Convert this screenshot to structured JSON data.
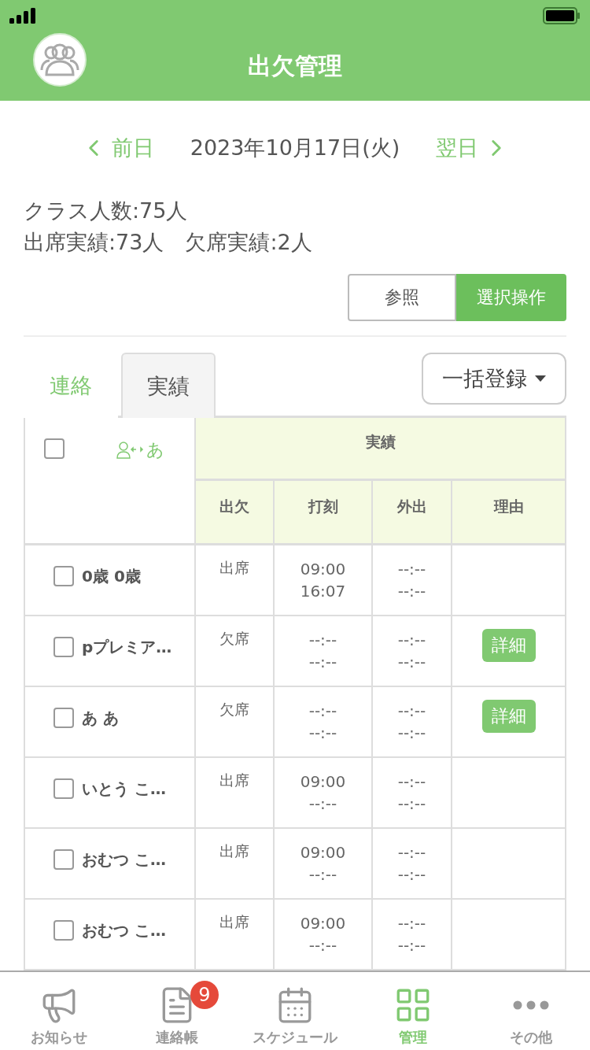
{
  "header": {
    "title": "出欠管理"
  },
  "date_nav": {
    "prev": "前日",
    "date": "2023年10月17日(火)",
    "next": "翌日"
  },
  "summary": [
    "クラス人数:75人",
    "出席実績:73人　欠席実績:2人"
  ],
  "mode_toggle": [
    {
      "label": "参照",
      "selected": false
    },
    {
      "label": "選択操作",
      "selected": true
    }
  ],
  "tabs": [
    {
      "label": "連絡",
      "selected": false
    },
    {
      "label": "実績",
      "selected": true
    }
  ],
  "bulk_button": "一括登録",
  "table": {
    "select_all_checked": false,
    "sort_label": "あ",
    "group_header": "実績",
    "columns": [
      "出欠",
      "打刻",
      "外出",
      "理由"
    ],
    "rows": [
      {
        "name": "0歳 0歳",
        "checked": false,
        "status": "出席",
        "stamp": [
          "09:00",
          "16:07"
        ],
        "out": [
          "--:--",
          "--:--"
        ],
        "reason": null
      },
      {
        "name": "pプレミア…",
        "checked": false,
        "status": "欠席",
        "stamp": [
          "--:--",
          "--:--"
        ],
        "out": [
          "--:--",
          "--:--"
        ],
        "reason": "詳細"
      },
      {
        "name": "あ あ",
        "checked": false,
        "status": "欠席",
        "stamp": [
          "--:--",
          "--:--"
        ],
        "out": [
          "--:--",
          "--:--"
        ],
        "reason": "詳細"
      },
      {
        "name": "いとう こ…",
        "checked": false,
        "status": "出席",
        "stamp": [
          "09:00",
          "--:--"
        ],
        "out": [
          "--:--",
          "--:--"
        ],
        "reason": null
      },
      {
        "name": "おむつ こ…",
        "checked": false,
        "status": "出席",
        "stamp": [
          "09:00",
          "--:--"
        ],
        "out": [
          "--:--",
          "--:--"
        ],
        "reason": null
      },
      {
        "name": "おむつ こ…",
        "checked": false,
        "status": "出席",
        "stamp": [
          "09:00",
          "--:--"
        ],
        "out": [
          "--:--",
          "--:--"
        ],
        "reason": null
      }
    ]
  },
  "bottom_nav": [
    {
      "kind": "megaphone",
      "label": "お知らせ",
      "selected": false
    },
    {
      "kind": "document",
      "label": "連絡帳",
      "selected": false,
      "badge": "9"
    },
    {
      "kind": "calendar",
      "label": "スケジュール",
      "selected": false
    },
    {
      "kind": "grid",
      "label": "管理",
      "selected": true
    },
    {
      "kind": "more",
      "label": "その他",
      "selected": false
    }
  ]
}
